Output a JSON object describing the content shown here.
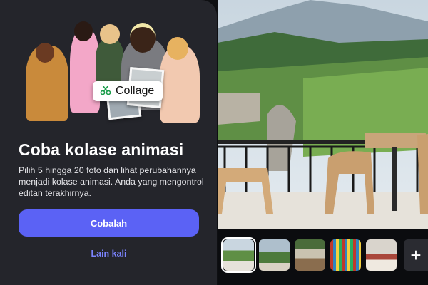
{
  "sheet": {
    "collage_label": "Collage",
    "title": "Coba kolase animasi",
    "description": "Pilih 5 hingga 20 foto dan lihat perubahannya menjadi kolase animasi. Anda yang mengontrol editan terakhirnya.",
    "primary_button": "Cobalah",
    "secondary_button": "Lain kali"
  },
  "gallery": {
    "thumbnails": [
      "photo-1",
      "photo-2",
      "photo-3",
      "photo-4",
      "photo-5"
    ],
    "selected_index": 0,
    "add_icon": "plus-icon"
  },
  "colors": {
    "accent": "#5b62f5",
    "link": "#7b84ff",
    "sheet_bg": "#24252b"
  }
}
